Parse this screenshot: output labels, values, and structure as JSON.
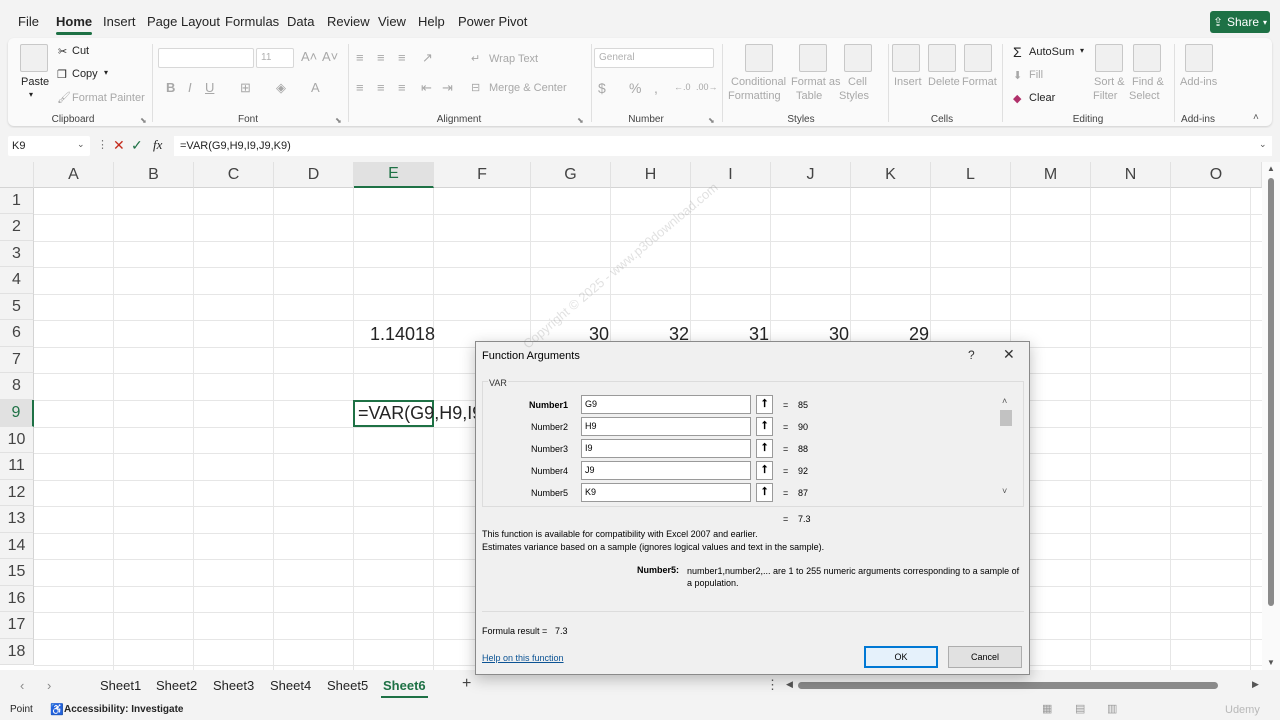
{
  "menu": {
    "tabs": [
      "File",
      "Home",
      "Insert",
      "Page Layout",
      "Formulas",
      "Data",
      "Review",
      "View",
      "Help",
      "Power Pivot"
    ],
    "active_tab": "Home",
    "share_label": "Share"
  },
  "ribbon": {
    "clipboard": {
      "paste": "Paste",
      "cut": "Cut",
      "copy": "Copy",
      "format_painter": "Format Painter",
      "label": "Clipboard"
    },
    "font": {
      "size": "11",
      "label": "Font"
    },
    "alignment": {
      "wrap_text": "Wrap Text",
      "merge_center": "Merge & Center",
      "label": "Alignment"
    },
    "number": {
      "format": "General",
      "label": "Number"
    },
    "styles": {
      "conditional": "Conditional",
      "formatting": "Formatting",
      "format_as": "Format as",
      "table": "Table",
      "cell": "Cell",
      "styles": "Styles",
      "label": "Styles"
    },
    "cells": {
      "insert": "Insert",
      "delete": "Delete",
      "format": "Format",
      "label": "Cells"
    },
    "editing": {
      "autosum": "AutoSum",
      "fill": "Fill",
      "clear": "Clear",
      "sort": "Sort &",
      "filter": "Filter",
      "find": "Find &",
      "select": "Select",
      "label": "Editing"
    },
    "addins": {
      "addins": "Add-ins",
      "label": "Add-ins"
    }
  },
  "formula_bar": {
    "name_box": "K9",
    "formula": "=VAR(G9,H9,I9,J9,K9)"
  },
  "grid": {
    "columns": [
      "A",
      "B",
      "C",
      "D",
      "E",
      "F",
      "G",
      "H",
      "I",
      "J",
      "K",
      "L",
      "M",
      "N",
      "O"
    ],
    "rows": [
      "1",
      "2",
      "3",
      "4",
      "5",
      "6",
      "7",
      "8",
      "9",
      "10",
      "11",
      "12",
      "13",
      "14",
      "15",
      "16",
      "17",
      "18"
    ],
    "e6": "1.14018",
    "g6": "30",
    "h6": "32",
    "i6": "31",
    "j6": "30",
    "k6": "29",
    "e9": "=VAR(G9,H9,I9,J9,K9)"
  },
  "dialog": {
    "title": "Function Arguments",
    "help": "?",
    "close": "✕",
    "function_name": "VAR",
    "args": [
      {
        "label": "Number1",
        "ref": "G9",
        "value": "85"
      },
      {
        "label": "Number2",
        "ref": "H9",
        "value": "90"
      },
      {
        "label": "Number3",
        "ref": "I9",
        "value": "88"
      },
      {
        "label": "Number4",
        "ref": "J9",
        "value": "92"
      },
      {
        "label": "Number5",
        "ref": "K9",
        "value": "87"
      }
    ],
    "result_inline": "7.3",
    "compat_note": "This function is available for compatibility with Excel 2007 and earlier.",
    "description": "Estimates variance based on a sample (ignores logical values and text in the sample).",
    "arg_name": "Number5:",
    "arg_description": "number1,number2,... are 1 to 255 numeric arguments corresponding to a sample of a population.",
    "formula_result_label": "Formula result =",
    "formula_result": "7.3",
    "help_link": "Help on this function",
    "ok": "OK",
    "cancel": "Cancel"
  },
  "sheets": {
    "tabs": [
      "Sheet1",
      "Sheet2",
      "Sheet3",
      "Sheet4",
      "Sheet5",
      "Sheet6"
    ],
    "active": "Sheet6"
  },
  "status": {
    "mode": "Point",
    "accessibility": "Accessibility: Investigate"
  },
  "watermark": "Copyright © 2025 - www.p30download.com",
  "brand_watermark": "Udemy",
  "colors": {
    "accent": "#1e7145",
    "dialog_bg": "#f0f0f0",
    "ok_border": "#0078d4"
  }
}
